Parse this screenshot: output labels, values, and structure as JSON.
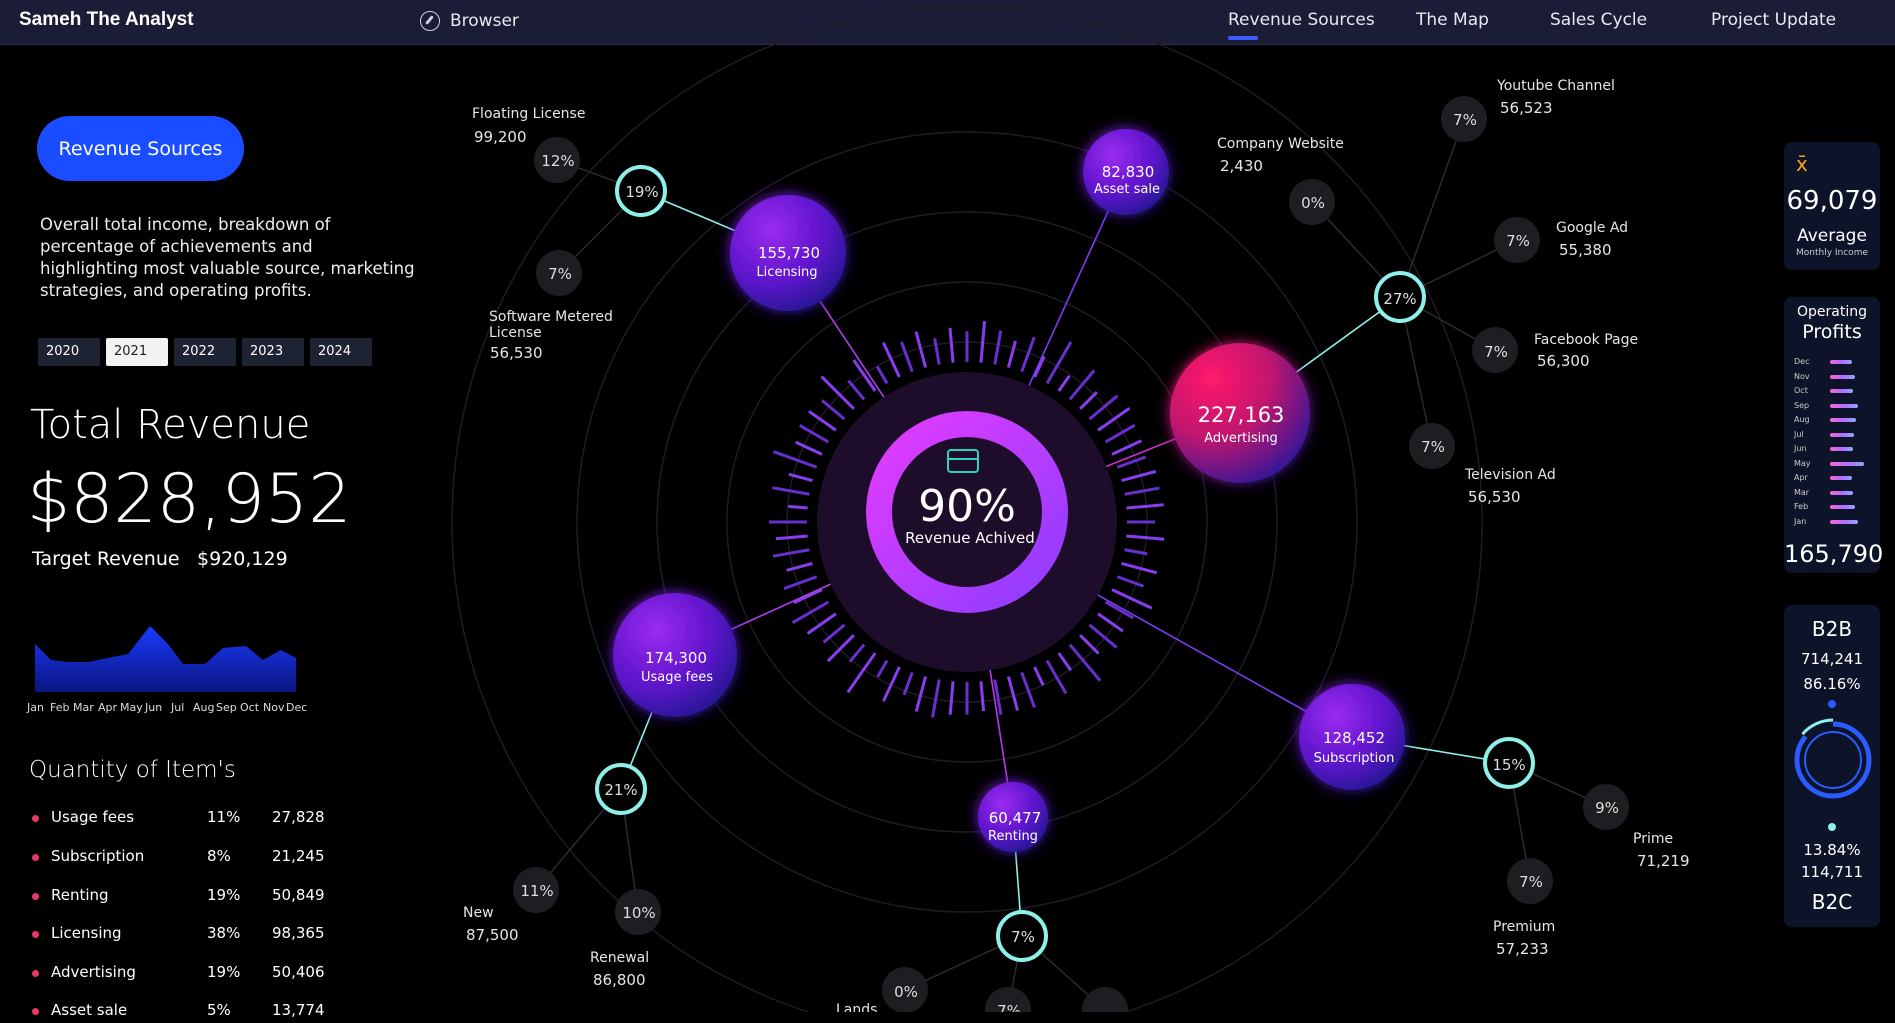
{
  "app": {
    "brand": "Sameh The Analyst",
    "browser_label": "Browser"
  },
  "nav": {
    "items": [
      "Revenue Sources",
      "The Map",
      "Sales Cycle",
      "Project Update"
    ],
    "active": "Revenue Sources"
  },
  "left": {
    "button": "Revenue Sources",
    "description": "Overall total income, breakdown of percentage of achievements and highlighting most valuable source, marketing strategies, and operating profits.",
    "years": [
      "2020",
      "2021",
      "2022",
      "2023",
      "2024"
    ],
    "selected_year": "2021",
    "total_title": "Total Revenue",
    "total_value": "$828,952",
    "target_label": "Target Revenue",
    "target_value": "$920,129",
    "months": [
      "Jan",
      "Feb",
      "Mar",
      "Apr",
      "May",
      "Jun",
      "Jul",
      "Aug",
      "Sep",
      "Oct",
      "Nov",
      "Dec"
    ],
    "quantity_title": "Quantity of Item's",
    "quantity_rows": [
      {
        "name": "Usage fees",
        "pct": "11%",
        "value": "27,828"
      },
      {
        "name": "Subscription",
        "pct": "8%",
        "value": "21,245"
      },
      {
        "name": "Renting",
        "pct": "19%",
        "value": "50,849"
      },
      {
        "name": "Licensing",
        "pct": "38%",
        "value": "98,365"
      },
      {
        "name": "Advertising",
        "pct": "19%",
        "value": "50,406"
      },
      {
        "name": "Asset sale",
        "pct": "5%",
        "value": "13,774"
      }
    ]
  },
  "center": {
    "pct": "90%",
    "label": "Revenue Achived"
  },
  "bubbles": [
    {
      "value": "155,730",
      "label": "Licensing"
    },
    {
      "value": "82,830",
      "label": "Asset sale"
    },
    {
      "value": "227,163",
      "label": "Advertising"
    },
    {
      "value": "174,300",
      "label": "Usage fees"
    },
    {
      "value": "128,452",
      "label": "Subscription"
    },
    {
      "value": "60,477",
      "label": "Renting"
    }
  ],
  "hubs": [
    "19%",
    "27%",
    "21%",
    "15%",
    "7%"
  ],
  "small_circles": [
    "12%",
    "7%",
    "7%",
    "0%",
    "7%",
    "7%",
    "7%",
    "11%",
    "10%",
    "9%",
    "7%",
    "0%",
    "7%"
  ],
  "ext_labels": [
    {
      "name": "Floating License",
      "value": "99,200"
    },
    {
      "name": "Software Metered",
      "name2": "License",
      "value": "56,530"
    },
    {
      "name": "Youtube Channel",
      "value": "56,523"
    },
    {
      "name": "Company Website",
      "value": "2,430"
    },
    {
      "name": "Google Ad",
      "value": "55,380"
    },
    {
      "name": "Facebook Page",
      "value": "56,300"
    },
    {
      "name": "Television Ad",
      "value": "56,530"
    },
    {
      "name": "Prime",
      "value": "71,219"
    },
    {
      "name": "Premium",
      "value": "57,233"
    },
    {
      "name": "New",
      "value": "87,500"
    },
    {
      "name": "Renewal",
      "value": "86,800"
    },
    {
      "name": "Lands",
      "value": ""
    }
  ],
  "right": {
    "avg_symbol": "x̄",
    "avg_value": "69,079",
    "avg_label": "Average",
    "avg_sub": "Monthly Income",
    "op_title": "Operating",
    "op_title2": "Profits",
    "op_months": [
      "Dec",
      "Nov",
      "Oct",
      "Sep",
      "Aug",
      "Jul",
      "Jun",
      "May",
      "Apr",
      "Mar",
      "Feb",
      "Jan"
    ],
    "op_levels": [
      0.55,
      0.62,
      0.58,
      0.7,
      0.66,
      0.6,
      0.58,
      0.86,
      0.56,
      0.58,
      0.62,
      0.7
    ],
    "op_total": "165,790",
    "b2b_label": "B2B",
    "b2b_value": "714,241",
    "b2b_pct": "86.16%",
    "b2c_pct": "13.84%",
    "b2c_value": "114,711",
    "b2c_label": "B2C",
    "b2b_share": 0.8616
  },
  "colors": {
    "accent": "#1a4dff",
    "cyan": "#8ff0ea",
    "magenta": "#e23cff",
    "pink": "#e8125c"
  }
}
